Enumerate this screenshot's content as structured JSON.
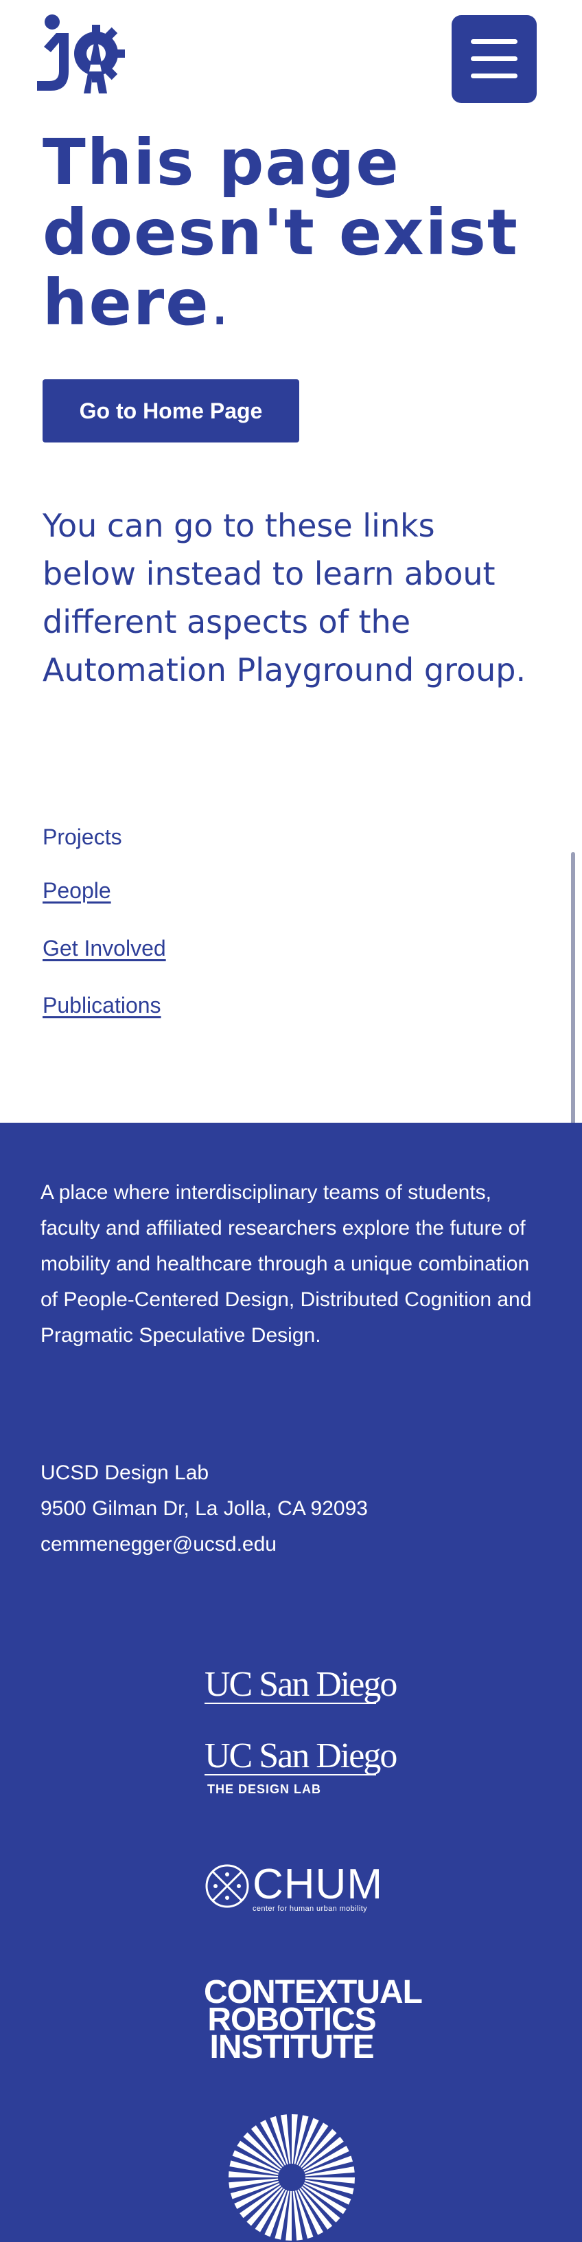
{
  "header": {
    "logo_icon": "automation-playground-logo-icon",
    "menu_icon": "hamburger-menu-icon"
  },
  "main": {
    "heading_lines": [
      "This page",
      "doesn't exist",
      "here"
    ],
    "heading_period": ".",
    "home_button_label": "Go to Home Page",
    "intro": "You can go to these links below instead to learn about different aspects of the Automation Playground group",
    "intro_period": ".",
    "links": [
      "Projects",
      "People",
      "Get Involved",
      "Publications"
    ]
  },
  "footer": {
    "description": "A place where interdisciplinary teams of students, faculty and affiliated researchers explore the future of mobility and healthcare through a unique combination of People-Centered Design, Distributed Cognition and Pragmatic Speculative Design.",
    "address": {
      "name": "UCSD Design Lab",
      "street": "9500 Gilman Dr, La Jolla, CA 92093",
      "email": "cemmenegger@ucsd.edu"
    },
    "partners": {
      "ucsd": "UC San Diego",
      "ucsd_design_lab": "UC San Diego",
      "ucsd_design_lab_sub": "THE DESIGN LAB",
      "chum": "CHUM",
      "chum_sub": "center for human urban mobility",
      "cri_lines": [
        "CONTEXTUAL",
        "ROBOTICS",
        "INSTITUTE"
      ],
      "sunburst_icon": "sunburst-logo-icon"
    }
  },
  "colors": {
    "brand_blue": "#2d3e98",
    "white": "#ffffff"
  }
}
